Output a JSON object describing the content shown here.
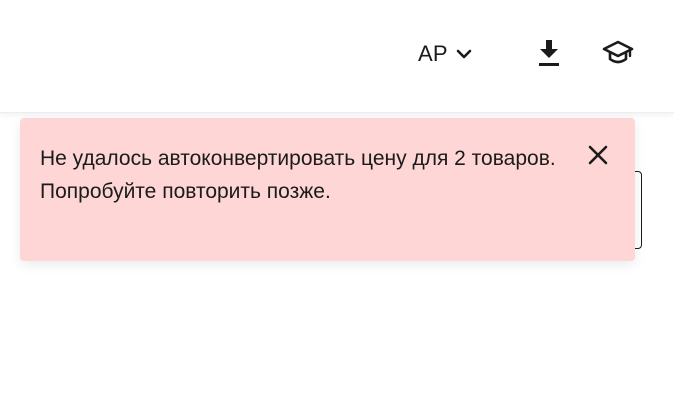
{
  "header": {
    "account_label": "AP",
    "icons": {
      "account_dropdown": "chevron-down-icon",
      "download": "download-icon",
      "education": "graduation-cap-icon"
    }
  },
  "toast": {
    "message": "Не удалось автоконвертировать цену для 2 товаров. Попробуйте повторить позже.",
    "close_icon": "close-icon",
    "background_color": "#ffd6d6"
  }
}
